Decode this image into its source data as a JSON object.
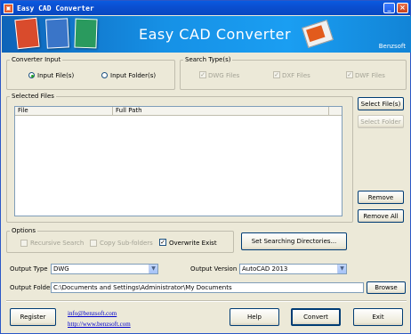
{
  "window": {
    "title": "Easy CAD Converter"
  },
  "banner": {
    "title": "Easy CAD Converter",
    "brand": "Benzsoft"
  },
  "converter_input": {
    "legend": "Converter Input",
    "options": [
      "Input File(s)",
      "Input Folder(s)"
    ],
    "selected": "Input File(s)"
  },
  "search_types": {
    "legend": "Search Type(s)",
    "items": [
      "DWG Files",
      "DXF Files",
      "DWF Files"
    ]
  },
  "selected_files": {
    "legend": "Selected Files",
    "columns": [
      "File",
      "Full Path"
    ]
  },
  "buttons": {
    "select_files": "Select File(s)",
    "select_folder": "Select Folder",
    "remove": "Remove",
    "remove_all": "Remove All",
    "set_dirs": "Set Searching Directories...",
    "browse": "Browse",
    "register": "Register",
    "help": "Help",
    "convert": "Convert",
    "exit": "Exit"
  },
  "options": {
    "legend": "Options",
    "recursive": "Recursive Search",
    "copy_sub": "Copy Sub-folders",
    "overwrite": "Overwrite Exist"
  },
  "output": {
    "type_label": "Output Type",
    "type_value": "DWG",
    "version_label": "Output Version",
    "version_value": "AutoCAD 2013",
    "folder_label": "Output Folder",
    "folder_value": "C:\\Documents and Settings\\Administrator\\My Documents"
  },
  "links": {
    "email": "info@benzsoft.com",
    "web": "http://www.benzsoft.com"
  }
}
